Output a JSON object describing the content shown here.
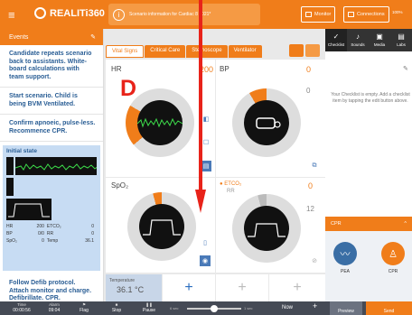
{
  "app": {
    "name": "REALITi360",
    "menu_icon": "hamburger-icon"
  },
  "topbar": {
    "scenario": "Scenario information for Cardiac 8 2021*",
    "monitor_btn": "Monitor",
    "connections_btn": "Connections",
    "battery": "100%"
  },
  "events": {
    "header": "Events",
    "items": [
      "Candidate repeats scenario back to assistants. White-board calculations with team support.",
      "Start scenario. Child is being BVM Ventilated.",
      "Confirm apnoeic, pulse-less. Recommence CPR."
    ],
    "state": {
      "title": "Initial state",
      "rows": [
        [
          "HR",
          "200",
          "ETCO₂",
          "0"
        ],
        [
          "BP",
          "0/0",
          "RR",
          "0"
        ],
        [
          "SpO₂",
          "0",
          "Temp",
          "36.1"
        ]
      ]
    },
    "last_item": "Follow Defib protocol. Attach monitor and charge. Defibrillate. CPR."
  },
  "monitor": {
    "tabs": [
      "Vital Signs",
      "Critical Care",
      "Stethoscope",
      "Ventilator"
    ],
    "hr": {
      "label": "HR",
      "value": "200"
    },
    "bp": {
      "label": "BP",
      "value1": "0",
      "value2": "0"
    },
    "spo2": {
      "label": "SpO₂",
      "value": "0"
    },
    "etco2": {
      "label": "ETCO₂",
      "sub": "RR",
      "value1": "0",
      "value2": "12"
    },
    "temp": {
      "label": "Temperature",
      "value": "36.1 °C"
    },
    "add": "+"
  },
  "right": {
    "tabs": [
      "Checklist",
      "Sounds",
      "Media",
      "Labs"
    ],
    "empty_text": "Your Checklist is empty. Add a checklist item by tapping the edit button above.",
    "cpr": {
      "header": "CPR",
      "items": [
        "PEA",
        "CPR"
      ]
    }
  },
  "bottom": {
    "time_label": "Time",
    "time_value": "00:00:56",
    "alarm_label": "Alarm",
    "alarm_value": "09:04",
    "flag": "Flag",
    "stop": "Stop",
    "pause": "Pause",
    "seg_left": "6 sec",
    "seg_right": "1 sec",
    "now": "Now",
    "preview": "Preview",
    "send": "Send"
  },
  "annotation": {
    "letter": "D"
  },
  "colors": {
    "accent": "#f07d1a",
    "link": "#2a5e95",
    "annotation": "#e8231a",
    "cpr_blue": "#3a6ea5",
    "cpr_orange": "#f07d1a"
  }
}
